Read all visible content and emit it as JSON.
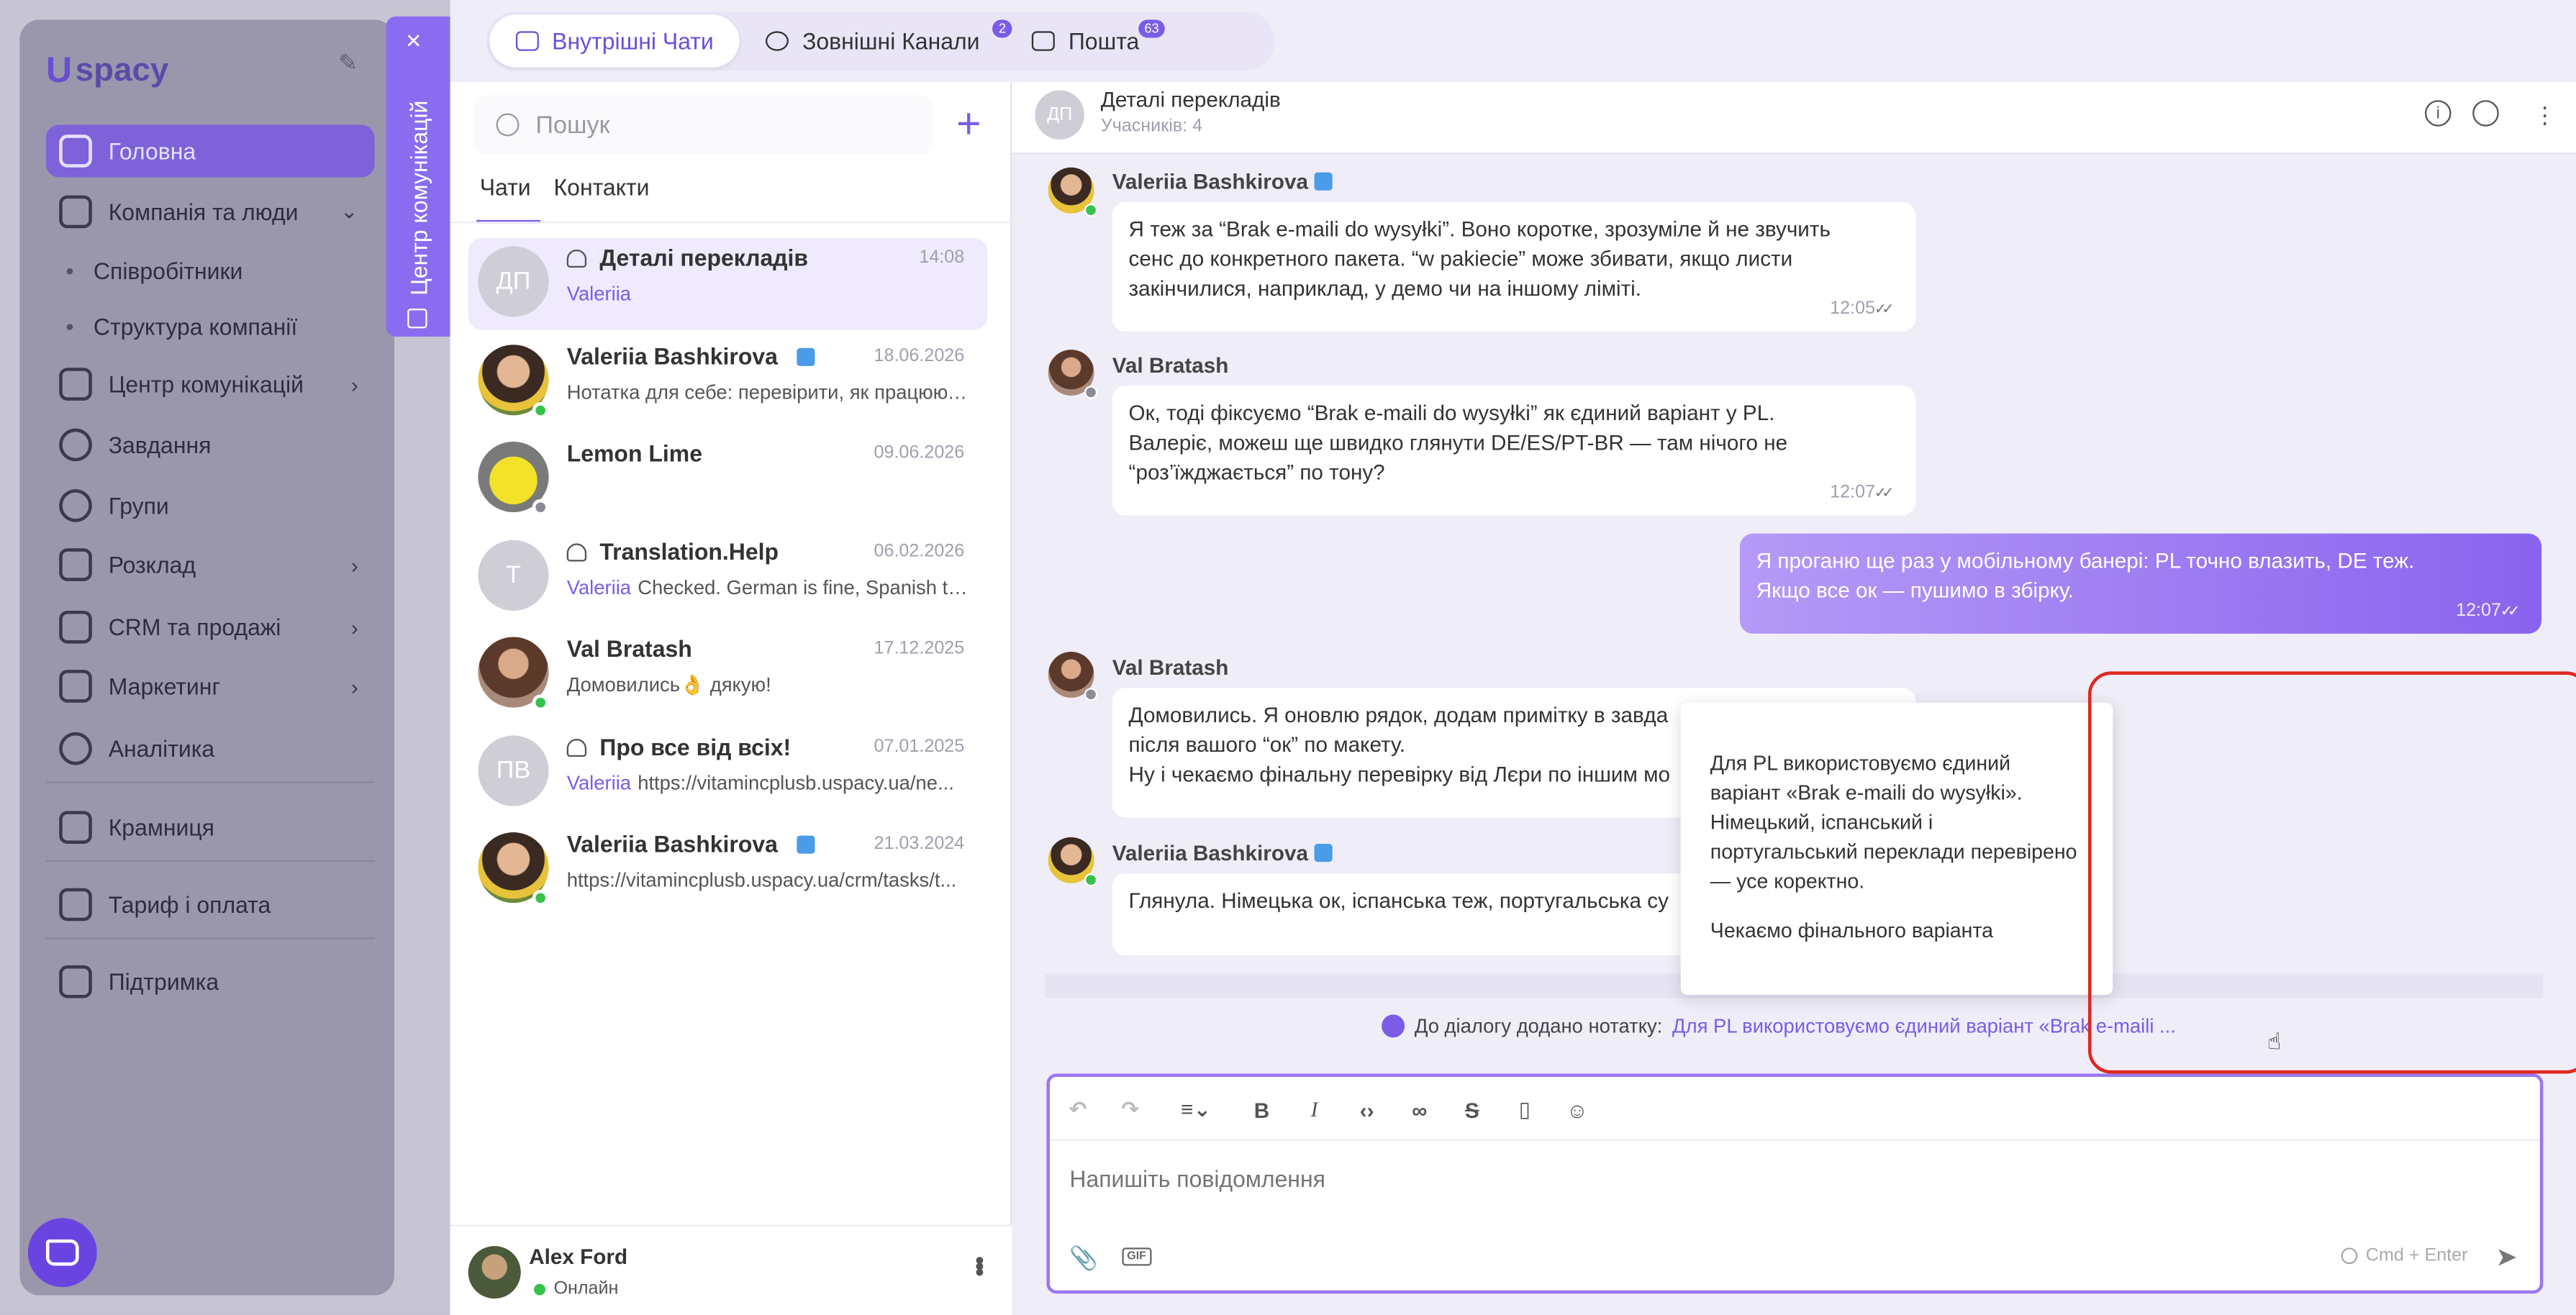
{
  "background": {
    "logo": "spacy",
    "nav": [
      {
        "label": "Головна",
        "active": true
      },
      {
        "label": "Компанія та люди"
      },
      {
        "label": "Співробітники"
      },
      {
        "label": "Структура компанії"
      },
      {
        "label": "Центр комунікацій"
      },
      {
        "label": "Завдання"
      },
      {
        "label": "Групи"
      },
      {
        "label": "Розклад"
      },
      {
        "label": "CRM та продажі"
      },
      {
        "label": "Маркетинг"
      },
      {
        "label": "Аналітика"
      },
      {
        "label": "Крамниця"
      },
      {
        "label": "Тариф і оплата"
      },
      {
        "label": "Підтримка"
      }
    ]
  },
  "side_tab": {
    "label": "Центр комунікацій",
    "close": "×"
  },
  "top_tabs": [
    {
      "label": "Внутрішні Чати",
      "active": true
    },
    {
      "label": "Зовнішні Канали",
      "badge": "2"
    },
    {
      "label": "Пошта",
      "badge": "63"
    }
  ],
  "chat_list": {
    "search_placeholder": "Пошук",
    "add": "+",
    "tabs": [
      "Чати",
      "Контакти"
    ],
    "items": [
      {
        "initials": "ДП",
        "name": "Деталі перекладів",
        "date": "14:08",
        "author": "Valeriia",
        "preview": ""
      },
      {
        "name": "Valeriia Bashkirova",
        "date": "18.06.2026",
        "author": "",
        "preview": "Нотатка для себе: перевірити, як працюют..."
      },
      {
        "name": "Lemon Lime",
        "date": "09.06.2026",
        "author": "",
        "preview": ""
      },
      {
        "initials": "T",
        "name": "Translation.Help",
        "date": "06.02.2026",
        "author": "Valeriia",
        "preview": "Checked. German is fine, Spanish to..."
      },
      {
        "name": "Val Bratash",
        "date": "17.12.2025",
        "author": "",
        "preview": "Домовились👌 дякую!"
      },
      {
        "initials": "ПВ",
        "name": "Про все від всіх!",
        "date": "07.01.2025",
        "author": "Valeriia",
        "preview": "https://vitamincplusb.uspacy.ua/ne..."
      },
      {
        "name": "Valeriia Bashkirova",
        "date": "21.03.2024",
        "author": "",
        "preview": "https://vitamincplusb.uspacy.ua/crm/tasks/t..."
      }
    ],
    "me": {
      "name": "Alex Ford",
      "status": "Онлайн"
    }
  },
  "conversation": {
    "initials": "ДП",
    "title": "Деталі перекладів",
    "subtitle": "Учасників: 4",
    "messages": [
      {
        "author": "Valeriia Bashkirova",
        "lines": [
          "Я теж за “Brak e-maili do wysyłki”. Воно коротке, зрозуміле й не звучить",
          "сенс до конкретного пакета. “w pakiecie” може збивати, якщо листи",
          "закінчилися, наприклад, у демо чи на іншому ліміті."
        ],
        "time": "12:05"
      },
      {
        "author": "Val Bratash",
        "lines": [
          "Ок, тоді фіксуємо “Brak e-maili do wysyłki” як єдиний варіант у PL.",
          "Валеріє, можеш ще швидко глянути DE/ES/PT-BR — там нічого не",
          "“роз’їжджається” по тону?"
        ],
        "time": "12:07"
      },
      {
        "author": "",
        "lines": [
          "Я проганю ще раз у мобільному банері: PL точно влазить, DE теж.",
          "Якщо все ок — пушимо в збірку."
        ],
        "time": "12:07"
      },
      {
        "author": "Val Bratash",
        "lines": [
          "Домовились. Я оновлю рядок, додам примітку в завда",
          "після вашого “ок” по макету.",
          "Ну і чекаємо фінальну перевірку від Лєри по іншим мо"
        ],
        "time": ""
      },
      {
        "author": "Valeriia Bashkirova",
        "lines": [
          "Глянула. Німецька ок, іспанська теж, португальська су"
        ],
        "time": ""
      }
    ],
    "separator": "Н",
    "note_prefix": "До діалогу додано нотатку:",
    "note_link": "Для PL використовуємо єдиний варіант «Brak e-maili ...",
    "tooltip": {
      "p1": "Для PL використовуємо єдиний варіант «Brak e-maili do wysyłki». Німецький, іспанський і португальський переклади перевірено — усе коректно.",
      "p2": "Чекаємо фінального варіанта"
    },
    "composer": {
      "placeholder": "Напишіть повідомлення",
      "hint": "Cmd + Enter",
      "gif": "GIF"
    }
  }
}
